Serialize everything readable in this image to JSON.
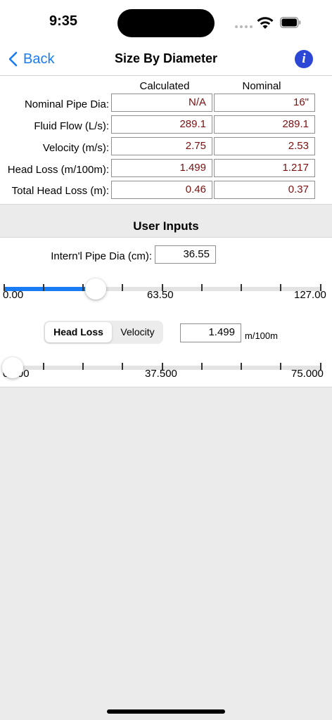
{
  "status": {
    "time": "9:35"
  },
  "nav": {
    "back_label": "Back",
    "title": "Size By Diameter",
    "info_icon": "i"
  },
  "results": {
    "col_calculated": "Calculated",
    "col_nominal": "Nominal",
    "rows": [
      {
        "label": "Nominal Pipe Dia:",
        "calculated": "N/A",
        "nominal": "16\""
      },
      {
        "label": "Fluid Flow (L/s):",
        "calculated": "289.1",
        "nominal": "289.1"
      },
      {
        "label": "Velocity (m/s):",
        "calculated": "2.75",
        "nominal": "2.53"
      },
      {
        "label": "Head Loss (m/100m):",
        "calculated": "1.499",
        "nominal": "1.217"
      },
      {
        "label": "Total Head Loss (m):",
        "calculated": "0.46",
        "nominal": "0.37"
      }
    ]
  },
  "inputs": {
    "section_title": "User Inputs",
    "pipe_dia_label": "Intern'l Pipe Dia (cm):",
    "pipe_dia_value": "36.55",
    "dia_slider": {
      "min_label": "0.00",
      "mid_label": "63.50",
      "max_label": "127.00",
      "level": 0.29
    },
    "segments": {
      "active": "Head Loss",
      "inactive": "Velocity"
    },
    "head_loss_value": "1.499",
    "head_loss_unit": "m/100m",
    "hl_slider": {
      "min_label": "0.000",
      "mid_label": "37.500",
      "max_label": "75.000",
      "level": 0.02
    }
  },
  "colors": {
    "accent": "#1a7cf2",
    "value_text": "#7a1010",
    "info": "#2c46d6"
  }
}
